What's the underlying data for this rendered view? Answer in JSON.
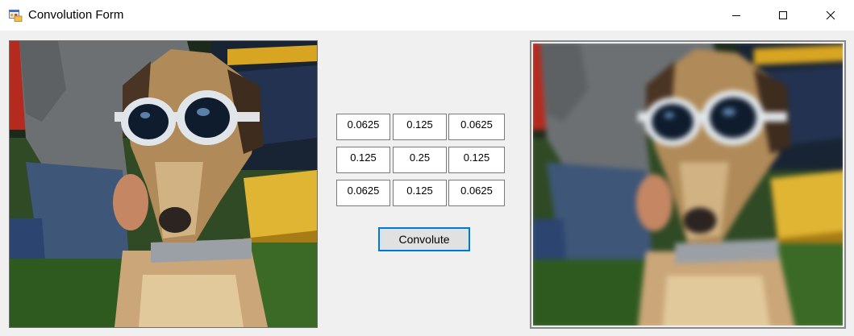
{
  "window": {
    "title": "Convolution Form",
    "icon": "app-form-icon",
    "controls": [
      "minimize-icon",
      "maximize-icon",
      "close-icon"
    ]
  },
  "kernel": {
    "rows": [
      [
        "0.0625",
        "0.125",
        "0.0625"
      ],
      [
        "0.125",
        "0.25",
        "0.125"
      ],
      [
        "0.0625",
        "0.125",
        "0.0625"
      ]
    ]
  },
  "actions": {
    "convolute_label": "Convolute"
  },
  "colors": {
    "titlebar_bg": "#ffffff",
    "client_bg": "#f0f0f0",
    "button_focus_border": "#0078d7",
    "button_bg": "#e1e1e1"
  }
}
